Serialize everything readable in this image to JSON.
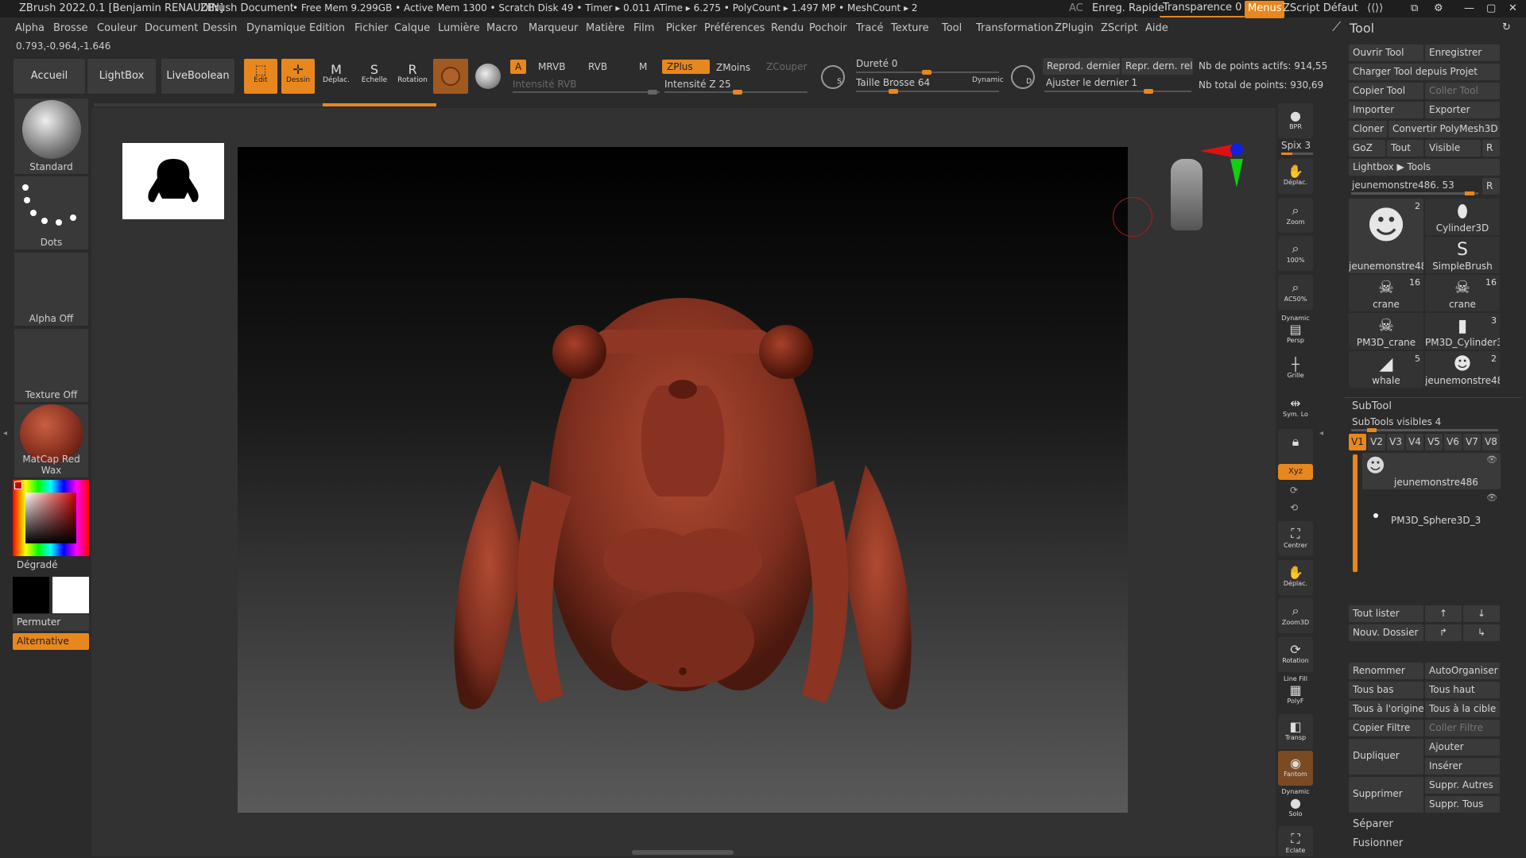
{
  "titlebar": {
    "app": "ZBrush 2022.0.1 [Benjamin RENAUDIN]",
    "doc": "ZBrush Document",
    "stats": "• Free Mem 9.299GB • Active Mem 1300 • Scratch Disk 49 • Timer ▸ 0.011 ATime ▸ 6.275 • PolyCount ▸ 1.497 MP • MeshCount ▸ 2",
    "ac": "AC",
    "quicksave": "Enreg. Rapide",
    "transparency": "Transparence 0",
    "menus": "Menus",
    "zscript": "ZScript Défaut"
  },
  "menubar": [
    "Alpha",
    "Brosse",
    "Couleur",
    "Document",
    "Dessin",
    "Dynamique",
    "Edition",
    "Fichier",
    "Calque",
    "Lumière",
    "Macro",
    "Marqueur",
    "Matière",
    "Film",
    "Picker",
    "Préférences",
    "Rendu",
    "Pochoir",
    "Tracé",
    "Texture",
    "Tool",
    "Transformation",
    "ZPlugin",
    "ZScript",
    "Aide"
  ],
  "coords": "0.793,-0.964,-1.646",
  "shelf": {
    "home": "Accueil",
    "lightbox": "LightBox",
    "liveboolean": "LiveBoolean",
    "edit": "Edit",
    "draw": "Dessin",
    "move": "Déplac.",
    "scale": "Echelle",
    "rotate": "Rotation",
    "a": "A",
    "mrvb": "MRVB",
    "rvb": "RVB",
    "m": "M",
    "intensity_rgb": "Intensité RVB",
    "zplus": "ZPlus",
    "zminus": "ZMoins",
    "zcut": "ZCouper",
    "intensity_z": "Intensité Z 25",
    "hardness": "Dureté 0",
    "brush_size": "Taille Brosse 64",
    "dynamic": "Dynamic",
    "s": "S",
    "d": "D",
    "replay_last": "Reprod. dernier",
    "replay_rel": "Repr. dern. rel.",
    "adjust_last": "Ajuster le dernier 1",
    "active_points": "Nb de points actifs: 914,55",
    "total_points": "Nb total de points: 930,69"
  },
  "left": {
    "standard": "Standard",
    "dots": "Dots",
    "alpha": "Alpha Off",
    "texture": "Texture Off",
    "matcap": "MatCap Red Wax",
    "gradient": "Dégradé",
    "swap": "Permuter",
    "alternate": "Alternative"
  },
  "right_shelf": {
    "bpr": "BPR",
    "spix": "Spix 3",
    "move": "Déplac.",
    "zoom": "Zoom",
    "z100": "100%",
    "ac50": "AC50%",
    "dynamic": "Dynamic",
    "persp": "Persp",
    "grid": "Grille",
    "sym": "Sym. Lo",
    "xyz": "Xyz",
    "center": "Centrer",
    "move2": "Déplac.",
    "zoom3d": "Zoom3D",
    "rotation": "Rotation",
    "linefill": "Line Fill",
    "polyf": "PolyF",
    "transp": "Transp",
    "fantom": "Fantom",
    "dynamic2": "Dynamic",
    "solo": "Solo",
    "eclate": "Eclate"
  },
  "tool": {
    "title": "Tool",
    "open": "Ouvrir Tool",
    "save": "Enregistrer",
    "load_project": "Charger Tool depuis Projet",
    "copy": "Copier Tool",
    "paste": "Coller Tool",
    "import": "Importer",
    "export": "Exporter",
    "clone": "Cloner",
    "polymesh": "Convertir PolyMesh3D",
    "goz": "GoZ",
    "all": "Tout",
    "visible": "Visible",
    "r": "R",
    "lightbox_tools": "Lightbox ▶ Tools",
    "current": "jeunemonstre486. 53",
    "r2": "R",
    "thumbs": [
      {
        "name": "jeunemonstre48",
        "count": "2",
        "icon": "☻"
      },
      {
        "name": "Cylinder3D",
        "count": "",
        "icon": "⬮"
      },
      {
        "name": "SimpleBrush",
        "count": "",
        "icon": "S"
      },
      {
        "name": "crane",
        "count": "16",
        "icon": "☠"
      },
      {
        "name": "crane",
        "count": "16",
        "icon": "☠"
      },
      {
        "name": "PM3D_crane",
        "count": "",
        "icon": "☠"
      },
      {
        "name": "PM3D_Cylinder3",
        "count": "3",
        "icon": "▮"
      },
      {
        "name": "whale",
        "count": "5",
        "icon": "◢"
      },
      {
        "name": "jeunemonstre48",
        "count": "2",
        "icon": "☻"
      }
    ],
    "subtool": "SubTool",
    "subtools_visible": "SubTools visibles 4",
    "v": [
      "V1",
      "V2",
      "V3",
      "V4",
      "V5",
      "V6",
      "V7",
      "V8"
    ],
    "items": [
      "jeunemonstre486",
      "PM3D_Sphere3D_3"
    ],
    "list_all": "Tout lister",
    "new_folder": "Nouv. Dossier",
    "rename": "Renommer",
    "autoorg": "AutoOrganiser",
    "all_low": "Tous bas",
    "all_high": "Tous haut",
    "all_origin": "Tous à l'origine",
    "all_target": "Tous à la cible",
    "copy_filter": "Copier Filtre",
    "paste_filter": "Coller Filtre",
    "duplicate": "Dupliquer",
    "add": "Ajouter",
    "insert": "Insérer",
    "delete": "Supprimer",
    "del_other": "Suppr. Autres",
    "del_all": "Suppr. Tous",
    "split": "Séparer",
    "merge": "Fusionner"
  },
  "colors": {
    "accent": "#e8871e",
    "bg": "#2b2b2b",
    "model": "#8a3424"
  }
}
